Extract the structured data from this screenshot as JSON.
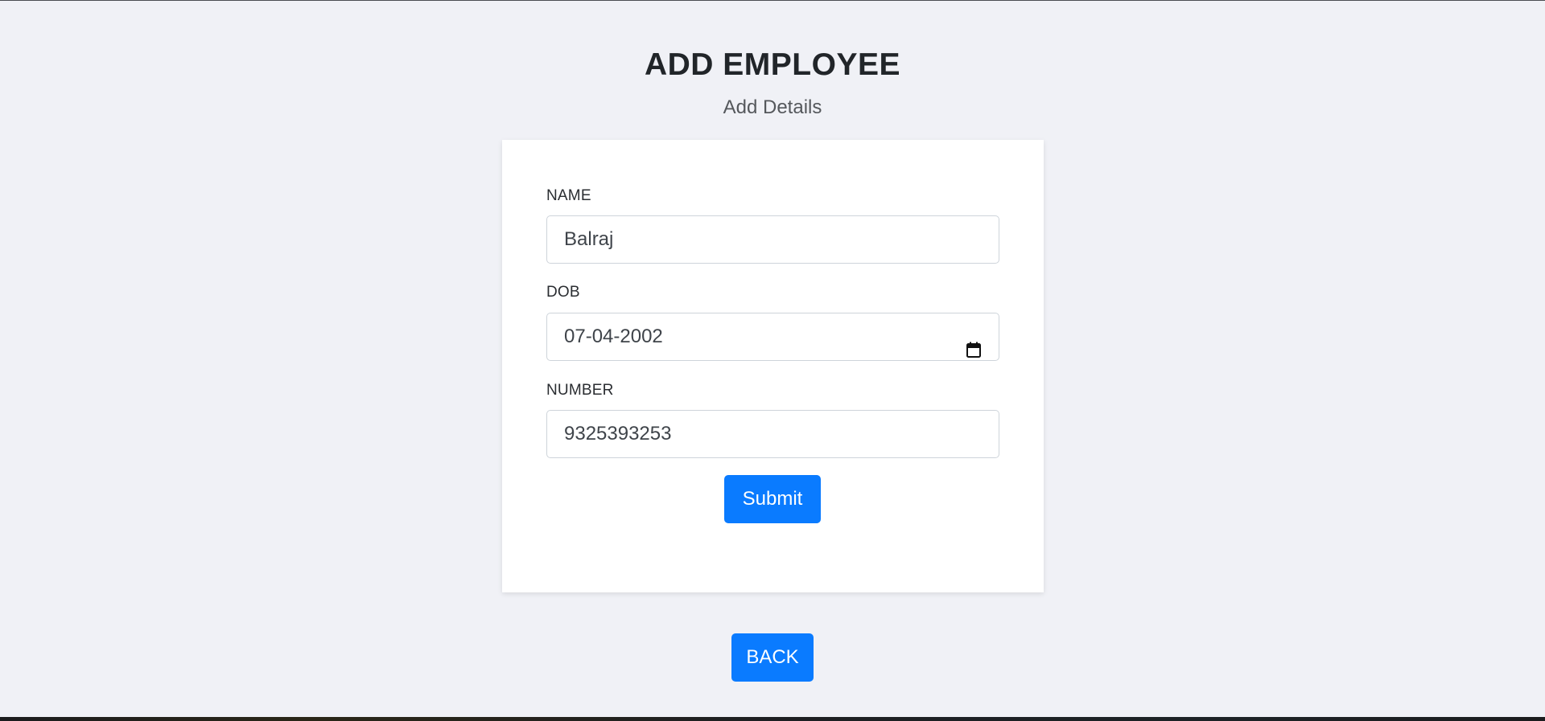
{
  "header": {
    "title": "ADD EMPLOYEE",
    "subtitle": "Add Details"
  },
  "form": {
    "name": {
      "label": "NAME",
      "value": "Balraj"
    },
    "dob": {
      "label": "DOB",
      "value": "07-04-2002",
      "icon": "calendar-icon"
    },
    "number": {
      "label": "NUMBER",
      "value": "9325393253"
    },
    "submit_label": "Submit"
  },
  "back_label": "BACK",
  "colors": {
    "background": "#f0f1f6",
    "card": "#ffffff",
    "primary_button": "#0a7bff",
    "heading_text": "#212529"
  }
}
